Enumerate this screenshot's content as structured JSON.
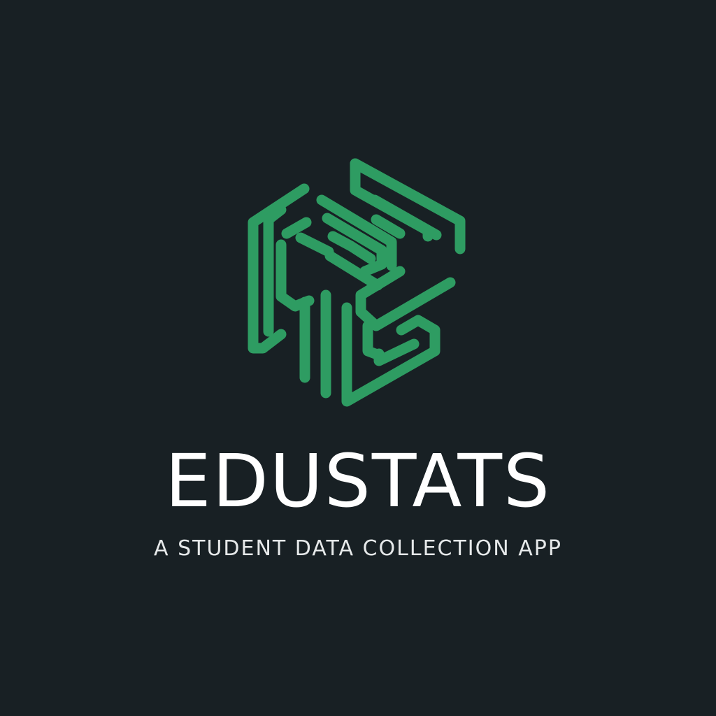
{
  "brand": {
    "name": "EDUSTATS",
    "tagline": "A STUDENT DATA COLLECTION APP"
  },
  "colors": {
    "background": "#182024",
    "logo_green": "#2e9c62",
    "text_primary": "#ffffff",
    "text_secondary": "#e6e9ea"
  },
  "logo": {
    "icon": "abstract-green-cube-maze-icon"
  }
}
